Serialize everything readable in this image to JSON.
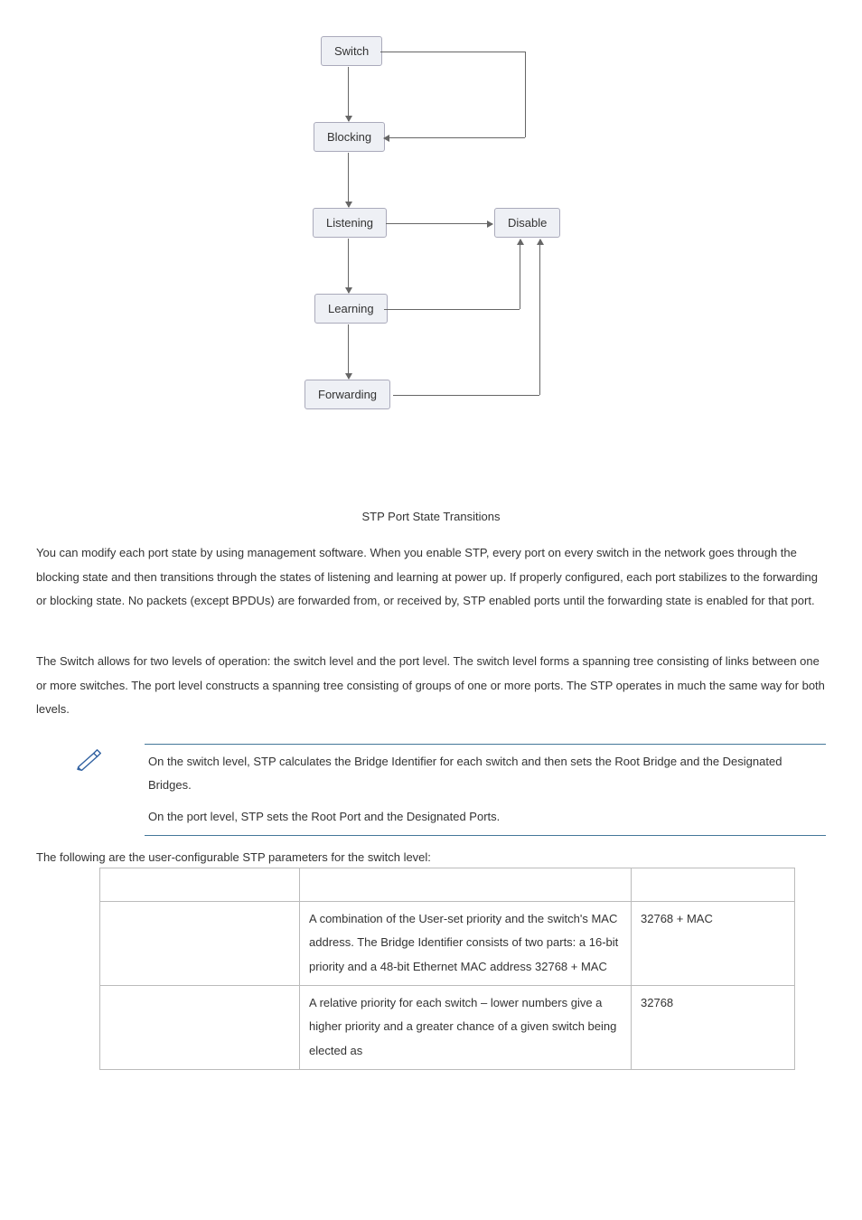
{
  "diagram": {
    "nodes": {
      "switch": "Switch",
      "blocking": "Blocking",
      "listening": "Listening",
      "disable": "Disable",
      "learning": "Learning",
      "forwarding": "Forwarding"
    },
    "caption": "STP Port State Transitions"
  },
  "para1": "You can modify each port state by using management software. When you enable STP, every port on every switch in the network goes through the blocking state and then transitions through the states of listening and learning at power up. If properly configured, each port stabilizes to the forwarding or blocking state. No packets (except BPDUs) are forwarded from, or received by, STP enabled ports until the forwarding state is enabled for that port.",
  "para2": "The Switch allows for two levels of operation: the switch level and the port level. The switch level forms a spanning tree consisting of links between one or more switches. The port level constructs a spanning tree consisting of groups of one or more ports. The STP operates in much the same way for both levels.",
  "note": {
    "line1": "On the switch level, STP calculates the Bridge Identifier for each switch and then sets the Root Bridge and the Designated Bridges.",
    "line2": "On the port level, STP sets the Root Port and the Designated Ports."
  },
  "table_lead": "The following are the user-configurable STP parameters for the switch level:",
  "table": {
    "headers": {
      "c1": "",
      "c2": "",
      "c3": ""
    },
    "rows": [
      {
        "c1": "",
        "c2": "A combination of the User-set priority and the switch's MAC address.\nThe Bridge Identifier consists of two parts: a 16-bit priority and a 48-bit Ethernet MAC address 32768 + MAC",
        "c3": "32768 + MAC"
      },
      {
        "c1": "",
        "c2": "A relative priority for each switch – lower numbers give a higher priority and a greater chance of a given switch being elected as",
        "c3": "32768"
      }
    ]
  }
}
